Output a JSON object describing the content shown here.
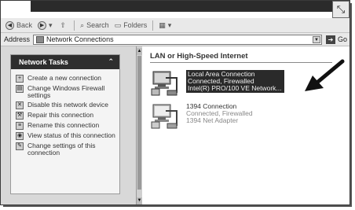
{
  "toolbar": {
    "back_label": "Back",
    "search_label": "Search",
    "folders_label": "Folders"
  },
  "address": {
    "label": "Address",
    "value": "Network Connections",
    "go_label": "Go"
  },
  "tasks": {
    "header": "Network Tasks",
    "items": [
      {
        "label": "Create a new connection",
        "icon": "new-connection-icon"
      },
      {
        "label": "Change Windows Firewall settings",
        "icon": "firewall-icon"
      },
      {
        "label": "Disable this network device",
        "icon": "disable-icon"
      },
      {
        "label": "Repair this connection",
        "icon": "repair-icon"
      },
      {
        "label": "Rename this connection",
        "icon": "rename-icon"
      },
      {
        "label": "View status of this connection",
        "icon": "status-icon"
      },
      {
        "label": "Change settings of this connection",
        "icon": "settings-icon"
      }
    ]
  },
  "content": {
    "group_title": "LAN or High-Speed Internet",
    "connections": [
      {
        "name": "Local Area Connection",
        "status": "Connected, Firewalled",
        "device": "Intel(R) PRO/100 VE Network...",
        "selected": true
      },
      {
        "name": "1394 Connection",
        "status": "Connected, Firewalled",
        "device": "1394 Net Adapter",
        "selected": false
      }
    ]
  },
  "colors": {
    "selection": "#2a2a2a",
    "task_header": "#2e2e2e"
  }
}
